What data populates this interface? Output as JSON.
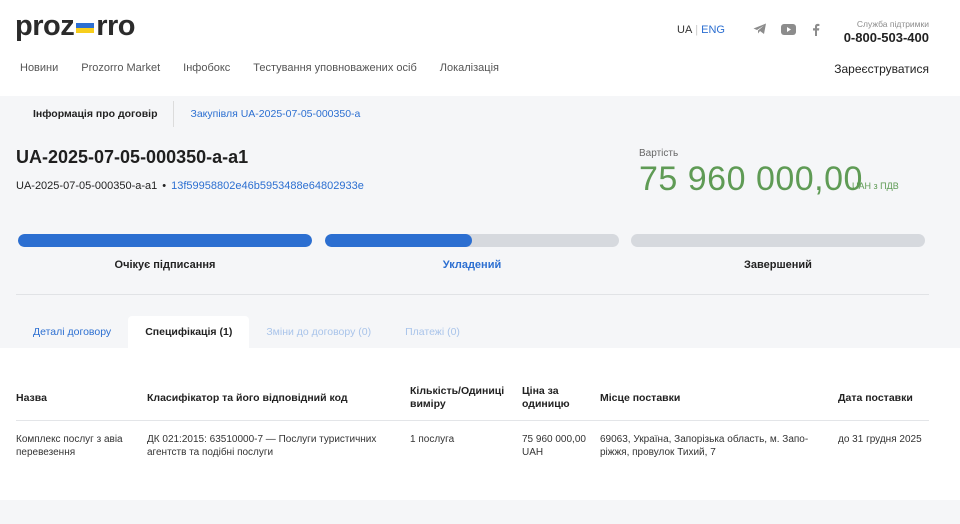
{
  "header": {
    "logo_left": "proz",
    "logo_right": "rro",
    "lang_ua": "UA",
    "lang_eng": "ENG",
    "support_label": "Служба підтримки",
    "support_phone": "0-800-503-400",
    "nav": [
      "Новини",
      "Prozorro Market",
      "Інфобокс",
      "Тестування уповноважених осіб",
      "Локалізація"
    ],
    "register": "Зареєструватися"
  },
  "breadcrumbs": {
    "contract_info": "Інформація про договір",
    "tender_link": "Закупівля UA-2025-07-05-000350-a"
  },
  "contract": {
    "title": "UA-2025-07-05-000350-a-a1",
    "id": "UA-2025-07-05-000350-a-a1",
    "separator": "•",
    "hash": "13f59958802e46b5953488e64802933e",
    "price_label": "Вартість",
    "price": "75 960 000,00",
    "price_currency": "UAH з ПДВ"
  },
  "progress": {
    "stages": [
      {
        "label": "Очікує підписання",
        "fill": 1.0,
        "active": false
      },
      {
        "label": "Укладений",
        "fill": 0.5,
        "active": true
      },
      {
        "label": "Завершений",
        "fill": 0.0,
        "active": false
      }
    ]
  },
  "tabs": [
    {
      "label": "Деталі договору",
      "state": "link"
    },
    {
      "label": "Специфікація (1)",
      "state": "active"
    },
    {
      "label": "Зміни до договору (0)",
      "state": "disabled"
    },
    {
      "label": "Платежі (0)",
      "state": "disabled"
    }
  ],
  "table": {
    "headers": [
      "Назва",
      "Класифікатор та його відповідний код",
      "Кількість/Одиниці виміру",
      "Ціна за одиницю",
      "Місце поставки",
      "Дата поставки"
    ],
    "rows": [
      [
        "Комплекс послуг з авіа перевезення",
        "ДК 021:2015: 63510000-7 — Послуги туристичних агентств та подібні послуги",
        "1 послуга",
        "75 960 000,00 UAH",
        "69063, Україна, Запорізька область, м. Запо-ріжжя, провулок Тихий, 7",
        "до 31 грудня 2025"
      ]
    ]
  },
  "colors": {
    "accent": "#2c6fd1",
    "price": "#5f9b55",
    "track": "#d6d9de"
  }
}
